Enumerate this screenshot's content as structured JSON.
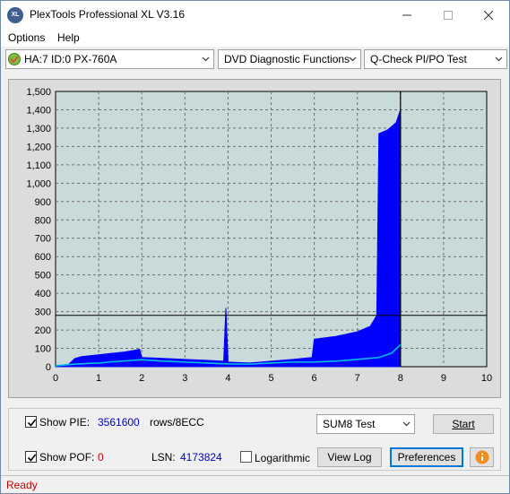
{
  "window": {
    "title": "PlexTools Professional XL V3.16",
    "icon_label": "XL"
  },
  "menu": {
    "options": "Options",
    "help": "Help"
  },
  "toolbar": {
    "drive": "HA:7 ID:0  PX-760A",
    "function": "DVD Diagnostic Functions",
    "test": "Q-Check PI/PO Test"
  },
  "chart_data": {
    "type": "area",
    "x_ticks": [
      "0",
      "1",
      "2",
      "3",
      "4",
      "5",
      "6",
      "7",
      "8",
      "9",
      "10"
    ],
    "y_ticks": [
      "0",
      "100",
      "200",
      "300",
      "400",
      "500",
      "600",
      "700",
      "800",
      "900",
      "1,000",
      "1,100",
      "1,200",
      "1,300",
      "1,400",
      "1,500"
    ],
    "xlim": [
      0,
      10
    ],
    "ylim": [
      0,
      1500
    ],
    "threshold": 280,
    "data_end_x": 8.0,
    "grid": true,
    "series": [
      {
        "color": "#0000ff",
        "points": [
          [
            0,
            5
          ],
          [
            0.3,
            12
          ],
          [
            0.45,
            45
          ],
          [
            0.6,
            55
          ],
          [
            0.8,
            60
          ],
          [
            1.0,
            65
          ],
          [
            1.2,
            70
          ],
          [
            1.4,
            75
          ],
          [
            1.6,
            80
          ],
          [
            1.8,
            88
          ],
          [
            1.95,
            95
          ],
          [
            2.0,
            50
          ],
          [
            2.5,
            45
          ],
          [
            3.0,
            40
          ],
          [
            3.5,
            35
          ],
          [
            3.9,
            30
          ],
          [
            3.95,
            320
          ],
          [
            4.0,
            25
          ],
          [
            4.5,
            20
          ],
          [
            5.0,
            30
          ],
          [
            5.5,
            40
          ],
          [
            5.95,
            50
          ],
          [
            6.0,
            150
          ],
          [
            6.5,
            165
          ],
          [
            7.0,
            190
          ],
          [
            7.3,
            220
          ],
          [
            7.45,
            280
          ],
          [
            7.5,
            1270
          ],
          [
            7.7,
            1290
          ],
          [
            7.9,
            1330
          ],
          [
            8.0,
            1400
          ]
        ]
      },
      {
        "color": "#00c0e0",
        "points": [
          [
            0,
            5
          ],
          [
            0.5,
            15
          ],
          [
            1.0,
            20
          ],
          [
            1.5,
            30
          ],
          [
            2.0,
            38
          ],
          [
            2.5,
            30
          ],
          [
            3.0,
            25
          ],
          [
            3.5,
            20
          ],
          [
            4.0,
            15
          ],
          [
            4.5,
            14
          ],
          [
            5.0,
            20
          ],
          [
            5.5,
            25
          ],
          [
            6.0,
            25
          ],
          [
            6.5,
            30
          ],
          [
            7.0,
            40
          ],
          [
            7.5,
            50
          ],
          [
            7.8,
            75
          ],
          [
            8.0,
            120
          ]
        ]
      }
    ]
  },
  "bottom": {
    "show_pie_label": "Show PIE:",
    "pie_value": "3561600",
    "pie_unit": "rows/8ECC",
    "show_pof_label": "Show POF:",
    "pof_value": "0",
    "lsn_label": "LSN:",
    "lsn_value": "4173824",
    "log_label": "Logarithmic",
    "test_mode": "SUM8 Test",
    "start": "Start",
    "view_log": "View Log",
    "preferences": "Preferences"
  },
  "status": {
    "text": "Ready"
  }
}
